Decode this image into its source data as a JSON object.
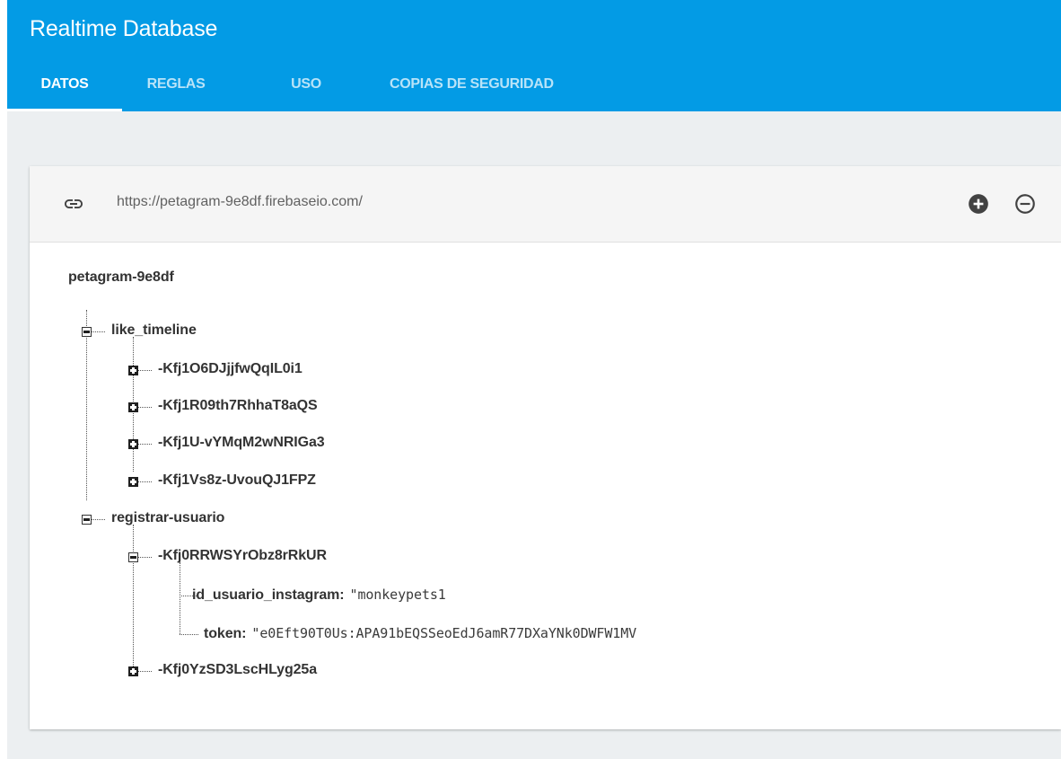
{
  "header": {
    "title": "Realtime Database",
    "tabs": [
      {
        "label": "DATOS",
        "active": true
      },
      {
        "label": "REGLAS",
        "active": false
      },
      {
        "label": "USO",
        "active": false
      },
      {
        "label": "COPIAS DE SEGURIDAD",
        "active": false
      }
    ]
  },
  "database": {
    "url": "https://petagram-9e8df.firebaseio.com/",
    "icons": {
      "link": "link-icon",
      "add": "add-circle-icon",
      "remove": "remove-circle-outline-icon"
    },
    "root": "petagram-9e8df",
    "like_timeline": {
      "key": "like_timeline",
      "expanded": true,
      "children": [
        "-Kfj1O6DJjjfwQqIL0i1",
        "-Kfj1R09th7RhhaT8aQS",
        "-Kfj1U-vYMqM2wNRIGa3",
        "-Kfj1Vs8z-UvouQJ1FPZ"
      ]
    },
    "registrar_usuario": {
      "key": "registrar-usuario",
      "expanded": true,
      "child1": {
        "key": "-Kfj0RRWSYrObz8rRkUR",
        "expanded": true,
        "fields": [
          {
            "name": "id_usuario_instagram:",
            "value": "\"monkeypets1"
          },
          {
            "name": "token:",
            "value": "\"e0Eft90T0Us:APA91bEQSSeoEdJ6amR77DXaYNk0DWFW1MV"
          }
        ]
      },
      "child2": {
        "key": "-Kfj0YzSD3LscHLyg25a",
        "expanded": false
      }
    }
  },
  "colors": {
    "header": "#039be5",
    "background": "#eceff1",
    "card": "#ffffff",
    "url_bar": "#f5f5f5"
  }
}
